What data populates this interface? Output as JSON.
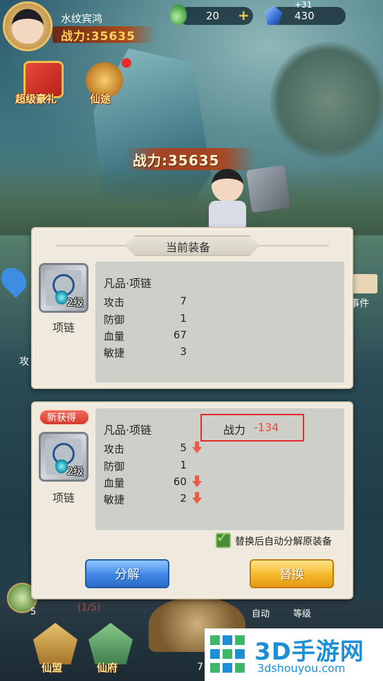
{
  "player": {
    "name": "水纹宾鸿",
    "power_label": "战力:35635"
  },
  "resources": {
    "jade_value": "20",
    "gem_bonus": "+31",
    "gem_value": "430"
  },
  "top_icons": {
    "gift_label": "超级豪礼",
    "sword_label": "仙途"
  },
  "scene": {
    "power_label": "战力:35635"
  },
  "side": {
    "left_label": "攻",
    "right_label": "事件"
  },
  "current_equipment": {
    "title": "当前装备",
    "item_name": "项链",
    "level": "2级",
    "grade": "凡品·项链",
    "stats": [
      {
        "label": "攻击",
        "value": "7"
      },
      {
        "label": "防御",
        "value": "1"
      },
      {
        "label": "血量",
        "value": "67"
      },
      {
        "label": "敏捷",
        "value": "3"
      }
    ]
  },
  "new_equipment": {
    "badge": "新获得",
    "item_name": "项链",
    "level": "2级",
    "grade": "凡品·项链",
    "power_label": "战力",
    "power_diff": "-134",
    "stats": [
      {
        "label": "攻击",
        "value": "5",
        "arrow": "down"
      },
      {
        "label": "防御",
        "value": "1",
        "arrow": "none"
      },
      {
        "label": "血量",
        "value": "60",
        "arrow": "down"
      },
      {
        "label": "敏捷",
        "value": "2",
        "arrow": "down"
      }
    ],
    "auto_dismantle_label": "替换后自动分解原装备",
    "auto_dismantle_checked": true
  },
  "buttons": {
    "dismantle": "分解",
    "replace": "替换"
  },
  "bottom": {
    "pet_level": "5",
    "pet_count": "(1/5)",
    "auto_label": "自动",
    "level_label": "等级",
    "guild_label": "仙盟",
    "mansion_label": "仙府",
    "number": "7"
  },
  "watermark": {
    "name": "3D手游网",
    "url": "3dshouyou.com"
  },
  "colors": {
    "gold": "#ffd35c",
    "red": "#e94a3a",
    "blue_button": "#3f86e4",
    "gold_button": "#f4b72a"
  }
}
